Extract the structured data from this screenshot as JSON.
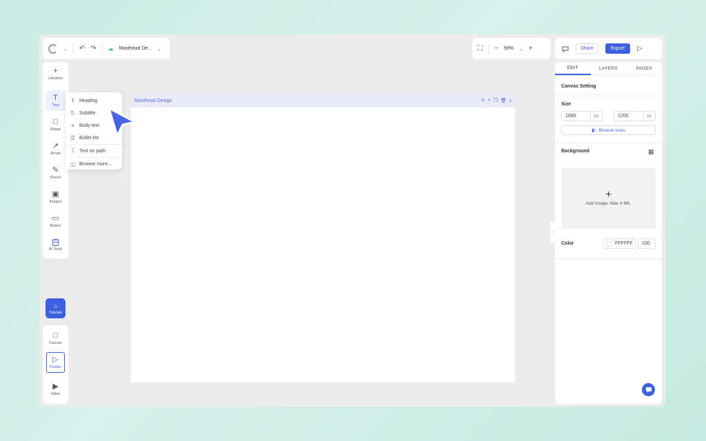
{
  "header": {
    "doc_title": "Masthead De...",
    "zoom": "59%",
    "share_label": "Share",
    "export_label": "Export"
  },
  "toolbar": {
    "items": [
      {
        "label": "Libraries",
        "icon": "plus-icon"
      },
      {
        "label": "Text",
        "icon": "text-icon"
      },
      {
        "label": "Shape",
        "icon": "square-icon"
      },
      {
        "label": "Arrow",
        "icon": "arrow-icon"
      },
      {
        "label": "Pencil",
        "icon": "pencil-icon"
      },
      {
        "label": "Images",
        "icon": "image-icon"
      },
      {
        "label": "Button",
        "icon": "button-icon"
      },
      {
        "label": "AI Tools",
        "icon": "ai-icon"
      }
    ],
    "tutorials_label": "Tutorials",
    "bottom": [
      {
        "label": "Canvas"
      },
      {
        "label": "Pointer"
      },
      {
        "label": "Video"
      }
    ],
    "accent": "#3e5fe0"
  },
  "text_menu": {
    "items": [
      "Heading",
      "Subtitle",
      "Body text",
      "Bullet list",
      "Text on path",
      "Browse more..."
    ]
  },
  "canvas": {
    "name": "Masthead Design"
  },
  "right_panel": {
    "tabs": [
      "EDIT",
      "LAYERS",
      "PAGES"
    ],
    "canvas_setting_title": "Canvas Setting",
    "size_label": "Size",
    "width": "1680",
    "height": "1200",
    "unit": "px",
    "browse_sizes": "Browse sizes",
    "background_label": "Background",
    "add_image_text": "Add Image. Max 4 Mb.",
    "color_label": "Color",
    "color_hex": "FFFFFF",
    "opacity": "100"
  }
}
